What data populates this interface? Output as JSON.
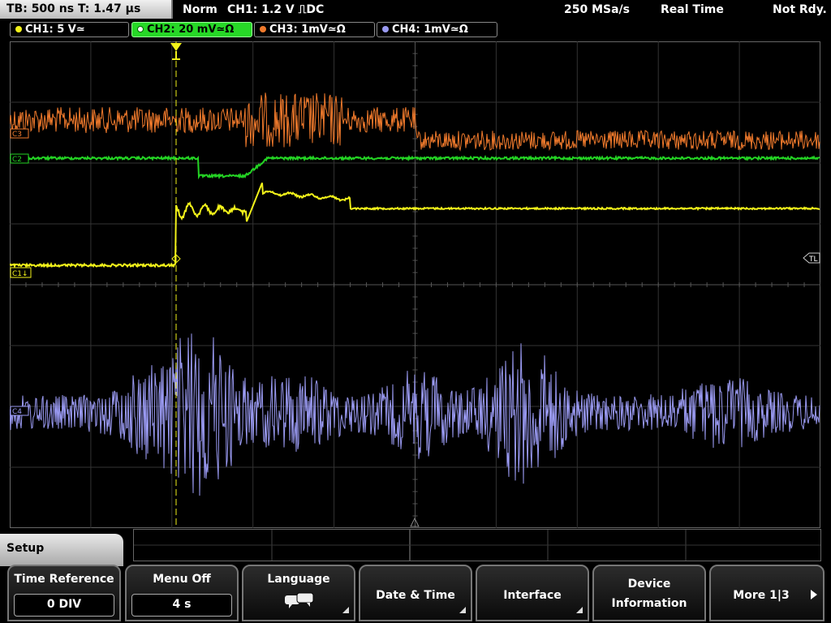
{
  "status_bar": {
    "timebase": "TB: 500 ns   T: 1.47 µs",
    "trigger_mode": "Norm",
    "trigger_info": "CH1: 1.2 V ⎍DC",
    "sample_rate": "250 MSa/s",
    "acquisition_mode": "Real Time",
    "state": "Not Rdy."
  },
  "channels": [
    {
      "label": "CH1: 5 V≃",
      "color": "#f2f21a",
      "marker": "C1"
    },
    {
      "label": "CH2: 20 mV≃Ω",
      "color": "#24d424",
      "marker": "C2"
    },
    {
      "label": "CH3: 1mV≃Ω",
      "color": "#f07a2c",
      "marker": "C3"
    },
    {
      "label": "CH4: 1mV≃Ω",
      "color": "#9a9af2",
      "marker": "C4"
    }
  ],
  "markers": {
    "trigger_level": "TL"
  },
  "menu": {
    "title": "Setup",
    "softkeys": [
      {
        "label": "Time Reference",
        "value": "0 DIV"
      },
      {
        "label": "Menu Off",
        "value": "4 s"
      },
      {
        "label": "Language",
        "icon": "speech-bubbles-icon"
      },
      {
        "label": "Date & Time"
      },
      {
        "label": "Interface"
      },
      {
        "label": "Device",
        "label2": "Information"
      },
      {
        "label": "More 1|3"
      }
    ]
  }
}
